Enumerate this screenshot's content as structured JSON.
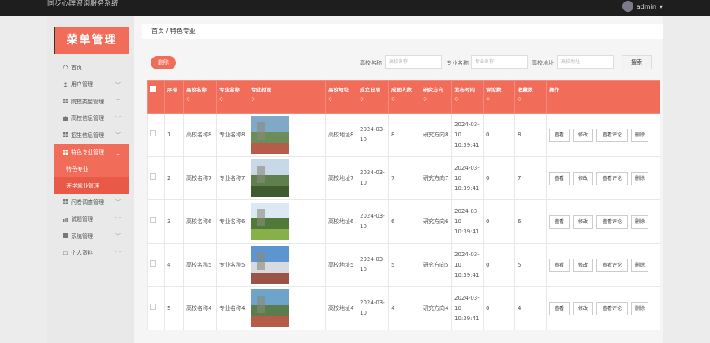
{
  "app": {
    "title": "同步心理咨询服务系统",
    "user": "admin"
  },
  "sidebar": {
    "title": "菜单管理",
    "items": [
      {
        "label": "首页",
        "icon": "home-icon",
        "chev": ""
      },
      {
        "label": "用户管理",
        "icon": "user-icon",
        "chev": "﹀"
      },
      {
        "label": "院校类型管理",
        "icon": "grid-icon",
        "chev": "﹀"
      },
      {
        "label": "高校信息管理",
        "icon": "building-icon",
        "chev": "﹀"
      },
      {
        "label": "招生信息管理",
        "icon": "grid-icon",
        "chev": "﹀"
      }
    ],
    "active_item": {
      "label": "特色专业管理",
      "icon": "grid-icon",
      "chev": "︿"
    },
    "submenu": [
      {
        "label": "特色专业"
      },
      {
        "label": "开学就业管理"
      }
    ],
    "items_after": [
      {
        "label": "问卷调查管理",
        "icon": "grid-icon",
        "chev": "﹀"
      },
      {
        "label": "试题管理",
        "icon": "chart-icon",
        "chev": "﹀"
      },
      {
        "label": "系统管理",
        "icon": "bar-icon",
        "chev": "﹀"
      },
      {
        "label": "个人资料",
        "icon": "card-icon",
        "chev": "﹀"
      }
    ]
  },
  "breadcrumb": "首页 / 特色专业",
  "toolbar": {
    "delete_label": "删除",
    "filters": [
      {
        "label": "高校名称",
        "placeholder": "高校名称"
      },
      {
        "label": "专业名称",
        "placeholder": "专业名称"
      },
      {
        "label": "高校地址",
        "placeholder": "高校地址"
      }
    ],
    "search_label": "搜索"
  },
  "table": {
    "headers": [
      "序号",
      "高校名称",
      "专业名称",
      "专业封面",
      "高校地址",
      "成立日期",
      "成团人数",
      "研究方向",
      "发布时间",
      "评论数",
      "收藏数",
      "操作"
    ],
    "sort_marker": "◇",
    "actions": [
      "查看",
      "修改",
      "查看评论",
      "删除"
    ],
    "rows": [
      {
        "no": "1",
        "school": "高校名称8",
        "major": "专业名称8",
        "address": "高校地址8",
        "date": "2024-03-10",
        "count": "8",
        "direction": "研究方向8",
        "published": "2024-03-10 10:39:41",
        "comments": "0",
        "favorites": "8"
      },
      {
        "no": "2",
        "school": "高校名称7",
        "major": "专业名称7",
        "address": "高校地址7",
        "date": "2024-03-10",
        "count": "7",
        "direction": "研究方向7",
        "published": "2024-03-10 10:39:41",
        "comments": "0",
        "favorites": "7"
      },
      {
        "no": "3",
        "school": "高校名称6",
        "major": "专业名称6",
        "address": "高校地址6",
        "date": "2024-03-10",
        "count": "6",
        "direction": "研究方向6",
        "published": "2024-03-10 10:39:41",
        "comments": "0",
        "favorites": "6"
      },
      {
        "no": "4",
        "school": "高校名称5",
        "major": "专业名称5",
        "address": "高校地址5",
        "date": "2024-03-10",
        "count": "5",
        "direction": "研究方向5",
        "published": "2024-03-10 10:39:41",
        "comments": "0",
        "favorites": "5"
      },
      {
        "no": "5",
        "school": "高校名称4",
        "major": "专业名称4",
        "address": "高校地址4",
        "date": "2024-03-10",
        "count": "4",
        "direction": "研究方向4",
        "published": "2024-03-10 10:39:41",
        "comments": "0",
        "favorites": "4"
      }
    ]
  },
  "colors": {
    "accent": "#f26c5a",
    "topbar": "#1e1e1e",
    "sidebar": "#e9e9e9"
  }
}
